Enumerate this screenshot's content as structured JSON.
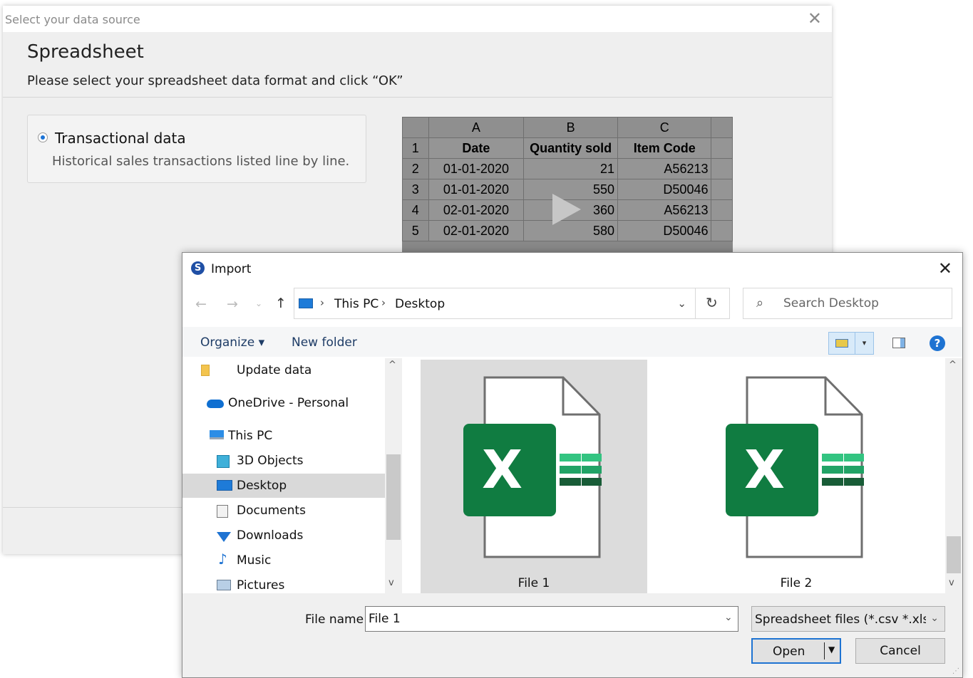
{
  "background_dialog": {
    "title": "Select your data source",
    "close_glyph": "✕",
    "heading": "Spreadsheet",
    "subtitle": "Please select your spreadsheet data format and click “OK”",
    "option": {
      "label": "Transactional data",
      "description": "Historical sales transactions listed line by line.",
      "selected": true
    },
    "preview": {
      "columns": [
        "A",
        "B",
        "C"
      ],
      "rows": [
        {
          "n": "1",
          "cells": [
            "Date",
            "Quantity sold",
            "Item Code"
          ]
        },
        {
          "n": "2",
          "cells": [
            "01-01-2020",
            "21",
            "A56213"
          ]
        },
        {
          "n": "3",
          "cells": [
            "01-01-2020",
            "550",
            "D50046"
          ]
        },
        {
          "n": "4",
          "cells": [
            "02-01-2020",
            "360",
            "A56213"
          ]
        },
        {
          "n": "5",
          "cells": [
            "02-01-2020",
            "580",
            "D50046"
          ]
        }
      ]
    }
  },
  "import_dialog": {
    "title": "Import",
    "app_icon": "S",
    "close_glyph": "✕",
    "nav": {
      "back": "←",
      "forward": "→",
      "recent": "⌄",
      "up": "↑"
    },
    "address": {
      "crumbs": [
        "This PC",
        "Desktop"
      ],
      "separator": "›",
      "dropdown": "⌄",
      "refresh": "↻"
    },
    "search": {
      "placeholder": "Search Desktop",
      "icon": "⌕"
    },
    "toolbar": {
      "organize": "Organize ▾",
      "new_folder": "New folder",
      "view_dropdown": "▾",
      "help": "?"
    },
    "nav_pane": [
      {
        "label": "Update data",
        "icon": "folder-icon"
      },
      {
        "label": "OneDrive - Personal",
        "icon": "cloud-icon"
      },
      {
        "label": "This PC",
        "icon": "computer-icon"
      },
      {
        "label": "3D Objects",
        "icon": "cube-icon"
      },
      {
        "label": "Desktop",
        "icon": "desktop-icon",
        "selected": true
      },
      {
        "label": "Documents",
        "icon": "documents-icon"
      },
      {
        "label": "Downloads",
        "icon": "download-icon"
      },
      {
        "label": "Music",
        "icon": "music-icon"
      },
      {
        "label": "Pictures",
        "icon": "pictures-icon"
      }
    ],
    "files": [
      {
        "name": "File 1",
        "selected": true
      },
      {
        "name": "File 2",
        "selected": false
      }
    ],
    "excel_letter": "X",
    "scroll": {
      "up": "^",
      "down": "v"
    },
    "file_name_label": "File name:",
    "file_name_value": "File 1",
    "file_type": "Spreadsheet files (*.csv *.xls *.xlsx)",
    "open_label": "Open",
    "open_arrow": "▼",
    "cancel_label": "Cancel",
    "colors": {
      "accent": "#1e73d2",
      "excel_green": "#107c41",
      "selection": "#dcdcdc"
    }
  }
}
